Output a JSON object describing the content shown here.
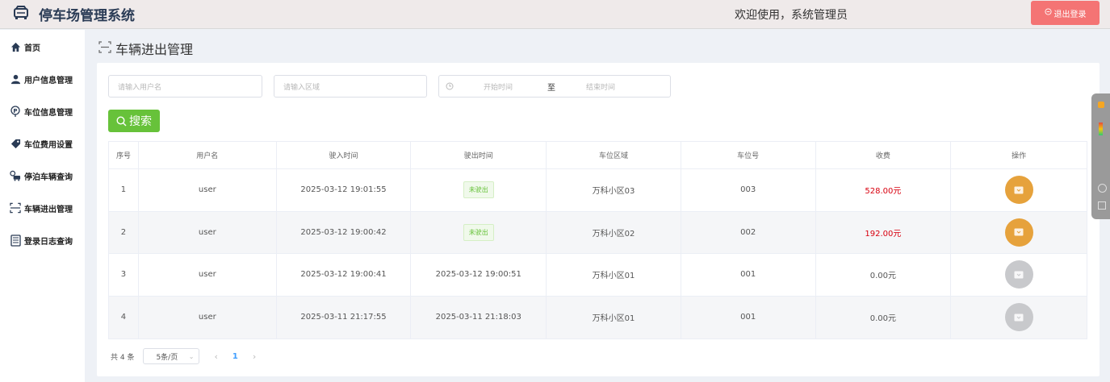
{
  "header": {
    "app_title": "停车场管理系统",
    "welcome": "欢迎使用，系统管理员",
    "logout_label": "退出登录"
  },
  "sidebar": {
    "items": [
      {
        "label": "首页",
        "icon": "home-icon"
      },
      {
        "label": "用户信息管理",
        "icon": "user-icon"
      },
      {
        "label": "车位信息管理",
        "icon": "parking-icon"
      },
      {
        "label": "车位费用设置",
        "icon": "tag-icon"
      },
      {
        "label": "停泊车辆查询",
        "icon": "car-query-icon"
      },
      {
        "label": "车辆进出管理",
        "icon": "scan-icon"
      },
      {
        "label": "登录日志查询",
        "icon": "log-icon"
      }
    ]
  },
  "page": {
    "title": "车辆进出管理"
  },
  "filters": {
    "username_placeholder": "请输入用户名",
    "area_placeholder": "请输入区域",
    "start_placeholder": "开始时间",
    "range_sep": "至",
    "end_placeholder": "结束时间",
    "search_label": "搜索"
  },
  "table": {
    "columns": [
      "序号",
      "用户名",
      "驶入时间",
      "驶出时间",
      "车位区域",
      "车位号",
      "收费",
      "操作"
    ],
    "rows": [
      {
        "index": "1",
        "user": "user",
        "in_time": "2025-03-12 19:01:55",
        "out_time": "未驶出",
        "area": "万科小区03",
        "spot": "003",
        "fee": "528.00元",
        "exited": false
      },
      {
        "index": "2",
        "user": "user",
        "in_time": "2025-03-12 19:00:42",
        "out_time": "未驶出",
        "area": "万科小区02",
        "spot": "002",
        "fee": "192.00元",
        "exited": false
      },
      {
        "index": "3",
        "user": "user",
        "in_time": "2025-03-12 19:00:41",
        "out_time": "2025-03-12 19:00:51",
        "area": "万科小区01",
        "spot": "001",
        "fee": "0.00元",
        "exited": true
      },
      {
        "index": "4",
        "user": "user",
        "in_time": "2025-03-11 21:17:55",
        "out_time": "2025-03-11 21:18:03",
        "area": "万科小区01",
        "spot": "001",
        "fee": "0.00元",
        "exited": true
      }
    ]
  },
  "pagination": {
    "total": "共 4 条",
    "page_size": "5条/页",
    "current": "1"
  },
  "colors": {
    "accent": "#409eff",
    "success": "#67c23a",
    "warning": "#e6a23c",
    "danger": "#f47474",
    "fee_red": "#d8000f"
  }
}
